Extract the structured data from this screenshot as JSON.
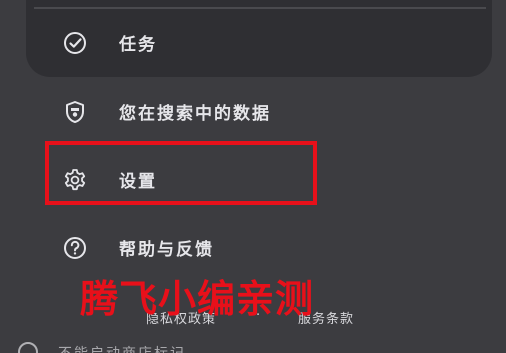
{
  "menu": {
    "items": [
      {
        "label": "任务",
        "icon": "check-circle-icon"
      },
      {
        "label": "您在搜索中的数据",
        "icon": "shield-icon"
      },
      {
        "label": "设置",
        "icon": "gear-icon"
      },
      {
        "label": "帮助与反馈",
        "icon": "help-circle-icon"
      }
    ]
  },
  "footer": {
    "privacy": "隐私权政策",
    "separator": "·",
    "terms": "服务条款"
  },
  "cut_off_item": {
    "label": "不能启动商店标记"
  },
  "watermark": "腾飞小编亲测",
  "colors": {
    "background": "#3c3c40",
    "card": "#2f2f33",
    "text": "#e6e6ea",
    "highlight": "#e8101a"
  }
}
